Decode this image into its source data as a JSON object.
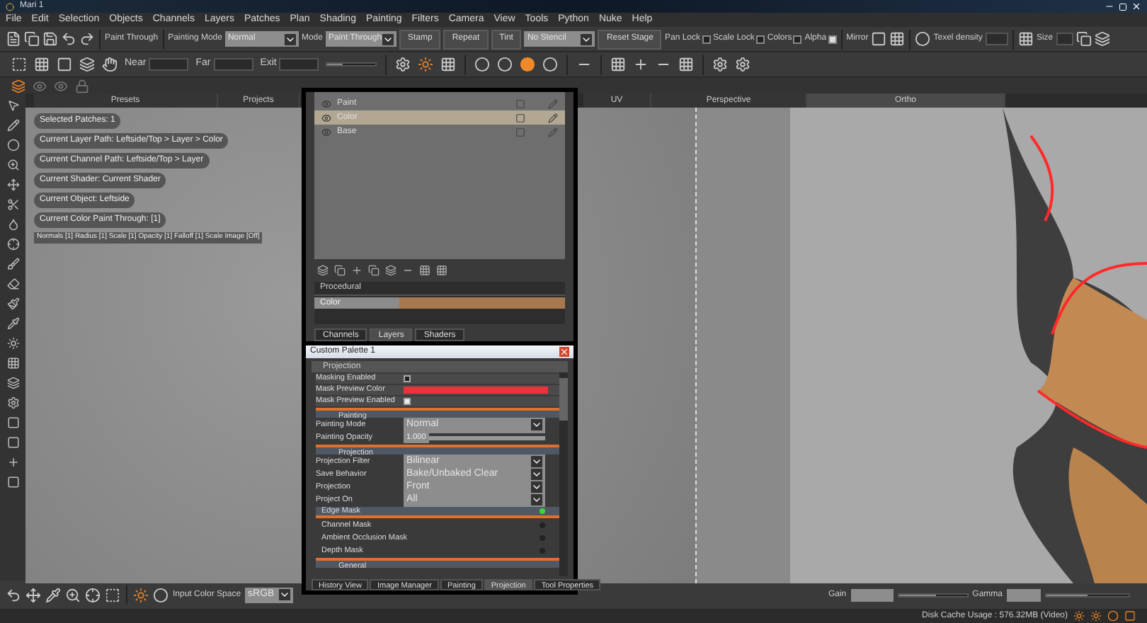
{
  "window": {
    "title": "Mari 1"
  },
  "menu": [
    "File",
    "Edit",
    "Selection",
    "Objects",
    "Channels",
    "Layers",
    "Patches",
    "Plan",
    "Shading",
    "Painting",
    "Filters",
    "Camera",
    "View",
    "Tools",
    "Python",
    "Nuke",
    "Help"
  ],
  "paint_toolbar": {
    "label": "Paint Through",
    "painting_mode_label": "Painting Mode",
    "painting_mode": "Normal",
    "mode_label": "Mode",
    "mode": "Paint Through",
    "buttons": [
      "Stamp",
      "Repeat",
      "Tint"
    ],
    "stencil": "No Stencil",
    "reset": "Reset Stage",
    "locks": [
      {
        "label": "Pan Lock",
        "checked": false
      },
      {
        "label": "Scale Lock",
        "checked": false
      },
      {
        "label": "Colors",
        "checked": false
      },
      {
        "label": "Alpha",
        "checked": true
      }
    ],
    "mirror_label": "Mirror",
    "texel_label": "Texel density",
    "size_label": "Size"
  },
  "clip_toolbar": {
    "fields": [
      "Near",
      "Far",
      "Exit"
    ],
    "level": 0.3
  },
  "viewport": {
    "tabs": [
      {
        "label": "Presets",
        "selected": false
      },
      {
        "label": "Projects",
        "selected": false
      },
      {
        "label": "UV",
        "selected": false
      },
      {
        "label": "Perspective",
        "selected": false
      },
      {
        "label": "Ortho",
        "selected": true
      }
    ],
    "hud": [
      "Selected Patches: 1",
      "Current Layer Path: Leftside/Top > Layer > Color",
      "Current Channel Path: Leftside/Top > Layer",
      "Current Shader: Current Shader",
      "Current Object: Leftside",
      "Current Color Paint Through: [1]"
    ],
    "info_line": "Normals [1]  Radius [1]  Scale [1]  Opacity [1]  Falloff [1]  Scale Image [Off]"
  },
  "layers_panel": {
    "layers": [
      {
        "name": "Paint",
        "selected": false
      },
      {
        "name": "Color",
        "selected": true
      },
      {
        "name": "Base",
        "selected": false
      }
    ],
    "procedural_title": "Procedural",
    "procedural_row": "Color",
    "tabs": [
      {
        "label": "Channels",
        "selected": false
      },
      {
        "label": "Layers",
        "selected": true
      },
      {
        "label": "Shaders",
        "selected": false
      }
    ]
  },
  "palette": {
    "title": "Custom Palette 1",
    "header": "Projection",
    "rows": [
      {
        "kind": "check",
        "label": "Masking Enabled",
        "checked": false
      },
      {
        "kind": "color",
        "label": "Mask Preview Color",
        "color": "#e8343a"
      },
      {
        "kind": "check",
        "label": "Mask Preview Enabled",
        "checked": true
      },
      {
        "kind": "section",
        "label": "Painting"
      },
      {
        "kind": "dropdown",
        "label": "Painting Mode",
        "value": "Normal"
      },
      {
        "kind": "slider",
        "label": "Painting Opacity",
        "value": "1.000",
        "level": 1
      },
      {
        "kind": "section",
        "label": "Projection"
      },
      {
        "kind": "dropdown",
        "label": "Projection Filter",
        "value": "Bilinear"
      },
      {
        "kind": "dropdown",
        "label": "Save Behavior",
        "value": "Bake/Unbaked Clear"
      },
      {
        "kind": "dropdown",
        "label": "Projection",
        "value": "Front"
      },
      {
        "kind": "dropdown",
        "label": "Project On",
        "value": "All"
      },
      {
        "kind": "mask",
        "label": "Edge Mask",
        "on": true,
        "selected": true
      },
      {
        "kind": "mask",
        "label": "Channel Mask",
        "on": false,
        "selected": false
      },
      {
        "kind": "mask",
        "label": "Ambient Occlusion Mask",
        "on": false,
        "selected": false
      },
      {
        "kind": "mask",
        "label": "Depth Mask",
        "on": false,
        "selected": false
      },
      {
        "kind": "section",
        "label": "General"
      }
    ],
    "tabs": [
      {
        "label": "History View",
        "selected": false
      },
      {
        "label": "Image Manager",
        "selected": false
      },
      {
        "label": "Painting",
        "selected": false
      },
      {
        "label": "Projection",
        "selected": true
      },
      {
        "label": "Tool Properties",
        "selected": false
      }
    ]
  },
  "bottom_bar": {
    "color_space_label": "Input Color Space",
    "color_space": "sRGB",
    "gain": {
      "label": "Gain",
      "level": 0.55
    },
    "gamma": {
      "label": "Gamma",
      "level": 0.5
    }
  },
  "status": "Disk Cache Usage : 576.32MB (Video)"
}
